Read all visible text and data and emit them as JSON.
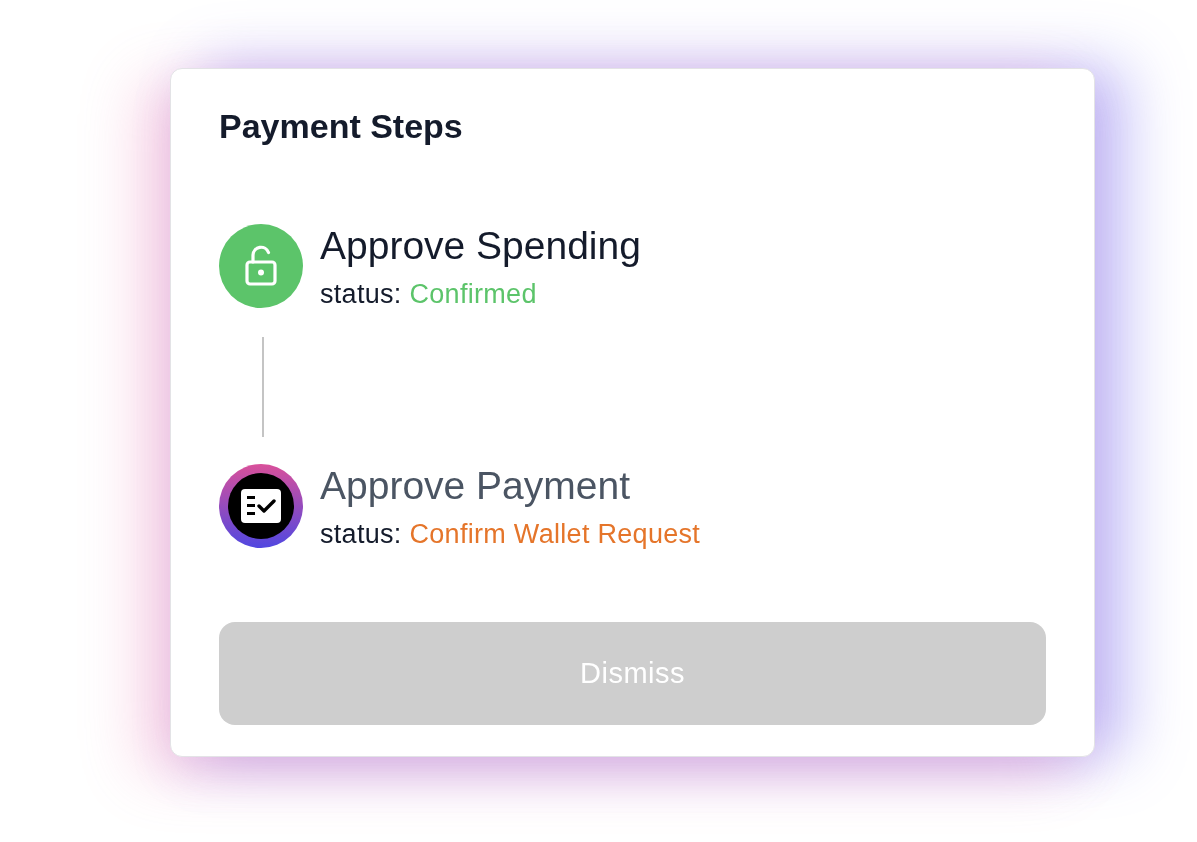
{
  "title": "Payment Steps",
  "steps": [
    {
      "kind": "approval",
      "done": true,
      "title": "Approve Spending",
      "status_label": "status:",
      "status": "Confirmed"
    },
    {
      "kind": "payment",
      "done": false,
      "title": "Approve Payment",
      "status_label": "status:",
      "status": "Confirm Wallet Request"
    }
  ],
  "dismiss_button": {
    "label": "Dismiss",
    "disabled": true
  }
}
